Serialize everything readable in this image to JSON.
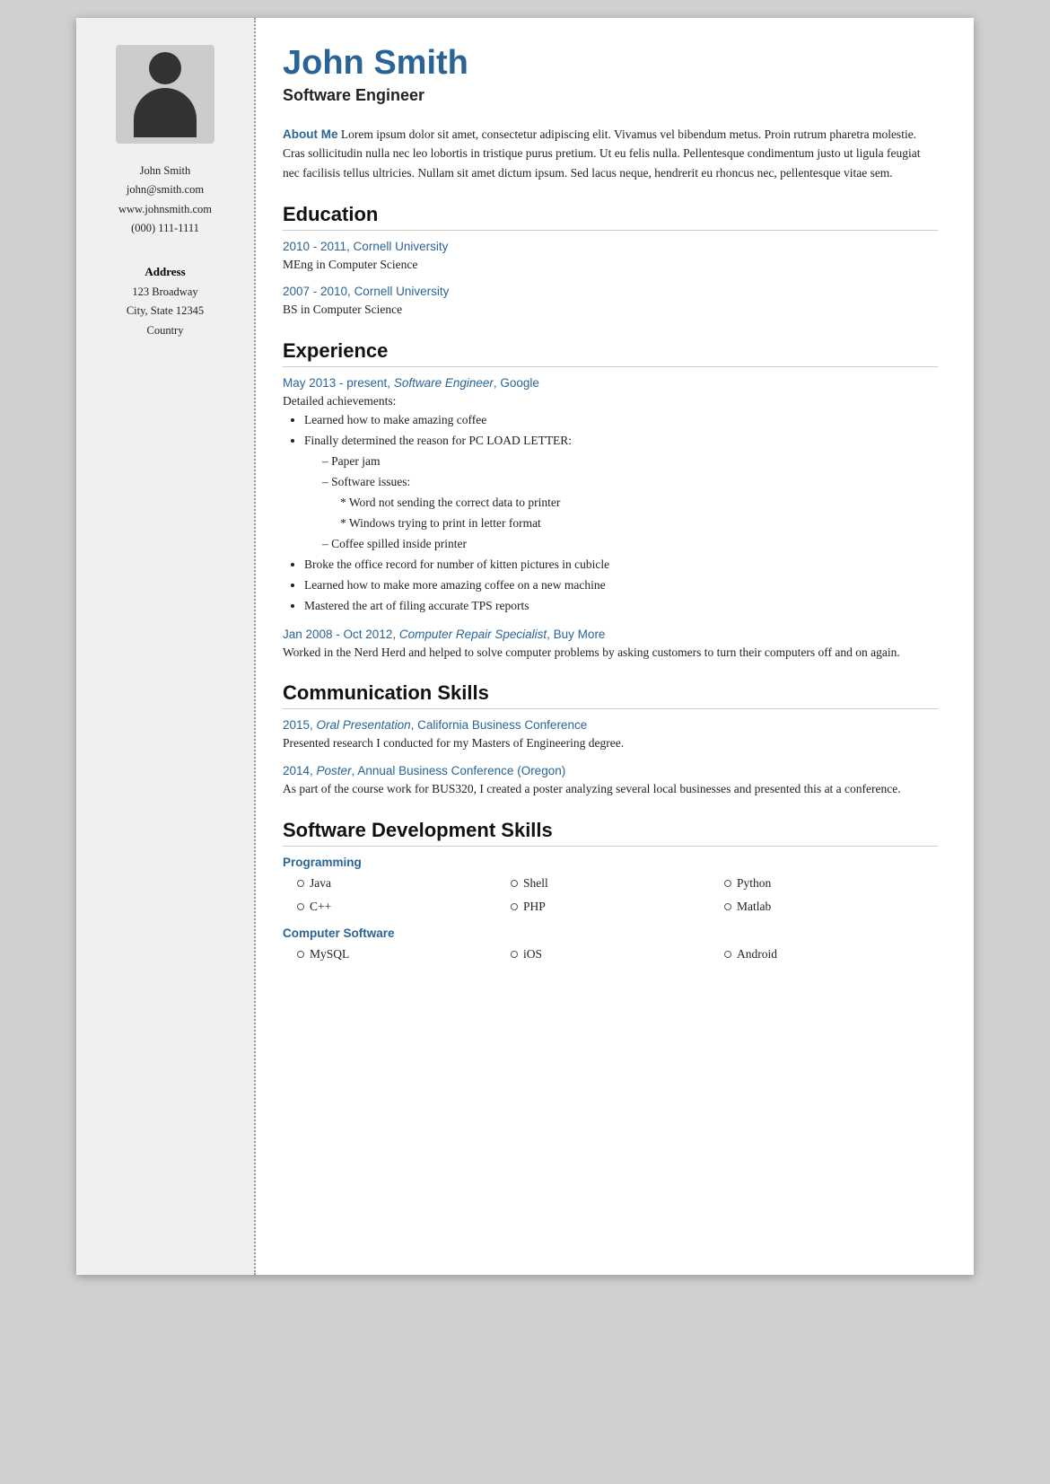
{
  "sidebar": {
    "name": "John Smith",
    "email": "john@smith.com",
    "website": "www.johnsmith.com",
    "phone": "(000) 111-1111",
    "address_label": "Address",
    "address_line1": "123 Broadway",
    "address_line2": "City, State 12345",
    "address_line3": "Country"
  },
  "header": {
    "name": "John Smith",
    "job_title": "Software Engineer"
  },
  "about_me": {
    "label": "About Me",
    "text": " Lorem ipsum dolor sit amet, consectetur adipiscing elit. Vivamus vel bibendum metus. Proin rutrum pharetra molestie. Cras sollicitudin nulla nec leo lobortis in tristique purus pretium. Ut eu felis nulla. Pellentesque condimentum justo ut ligula feugiat nec facilisis tellus ultricies. Nullam sit amet dictum ipsum. Sed lacus neque, hendrerit eu rhoncus nec, pellentesque vitae sem."
  },
  "education": {
    "heading": "Education",
    "entries": [
      {
        "title": "2010 - 2011, Cornell University",
        "desc": "MEng in Computer Science"
      },
      {
        "title": "2007 - 2010, Cornell University",
        "desc": "BS in Computer Science"
      }
    ]
  },
  "experience": {
    "heading": "Experience",
    "entries": [
      {
        "title": "May 2013 - present, Software Engineer, Google",
        "has_bullets": true,
        "intro": "Detailed achievements:",
        "bullets": [
          "Learned how to make amazing coffee",
          "Finally determined the reason for PC LOAD LETTER:",
          "Broke the office record for number of kitten pictures in cubicle",
          "Learned how to make more amazing coffee on a new machine",
          "Mastered the art of filing accurate TPS reports"
        ],
        "sub_bullets_index": 1,
        "sub_bullets": [
          "Paper jam",
          "Software issues:"
        ],
        "sub_sub_bullets": [
          "Word not sending the correct data to printer",
          "Windows trying to print in letter format"
        ],
        "sub_bullet3": "Coffee spilled inside printer"
      },
      {
        "title": "Jan 2008 - Oct 2012, Computer Repair Specialist, Buy More",
        "has_bullets": false,
        "desc": "Worked in the Nerd Herd and helped to solve computer problems by asking customers to turn their computers off and on again."
      }
    ]
  },
  "communication_skills": {
    "heading": "Communication Skills",
    "entries": [
      {
        "title": "2015, Oral Presentation, California Business Conference",
        "desc": "Presented research I conducted for my Masters of Engineering degree."
      },
      {
        "title": "2014, Poster, Annual Business Conference (Oregon)",
        "desc": "As part of the course work for BUS320, I created a poster analyzing several local businesses and presented this at a conference."
      }
    ]
  },
  "software_skills": {
    "heading": "Software Development Skills",
    "categories": [
      {
        "label": "Programming",
        "skills": [
          "Java",
          "Shell",
          "Python",
          "C++",
          "PHP",
          "Matlab"
        ]
      },
      {
        "label": "Computer Software",
        "skills": [
          "MySQL",
          "iOS",
          "Android"
        ]
      }
    ]
  }
}
